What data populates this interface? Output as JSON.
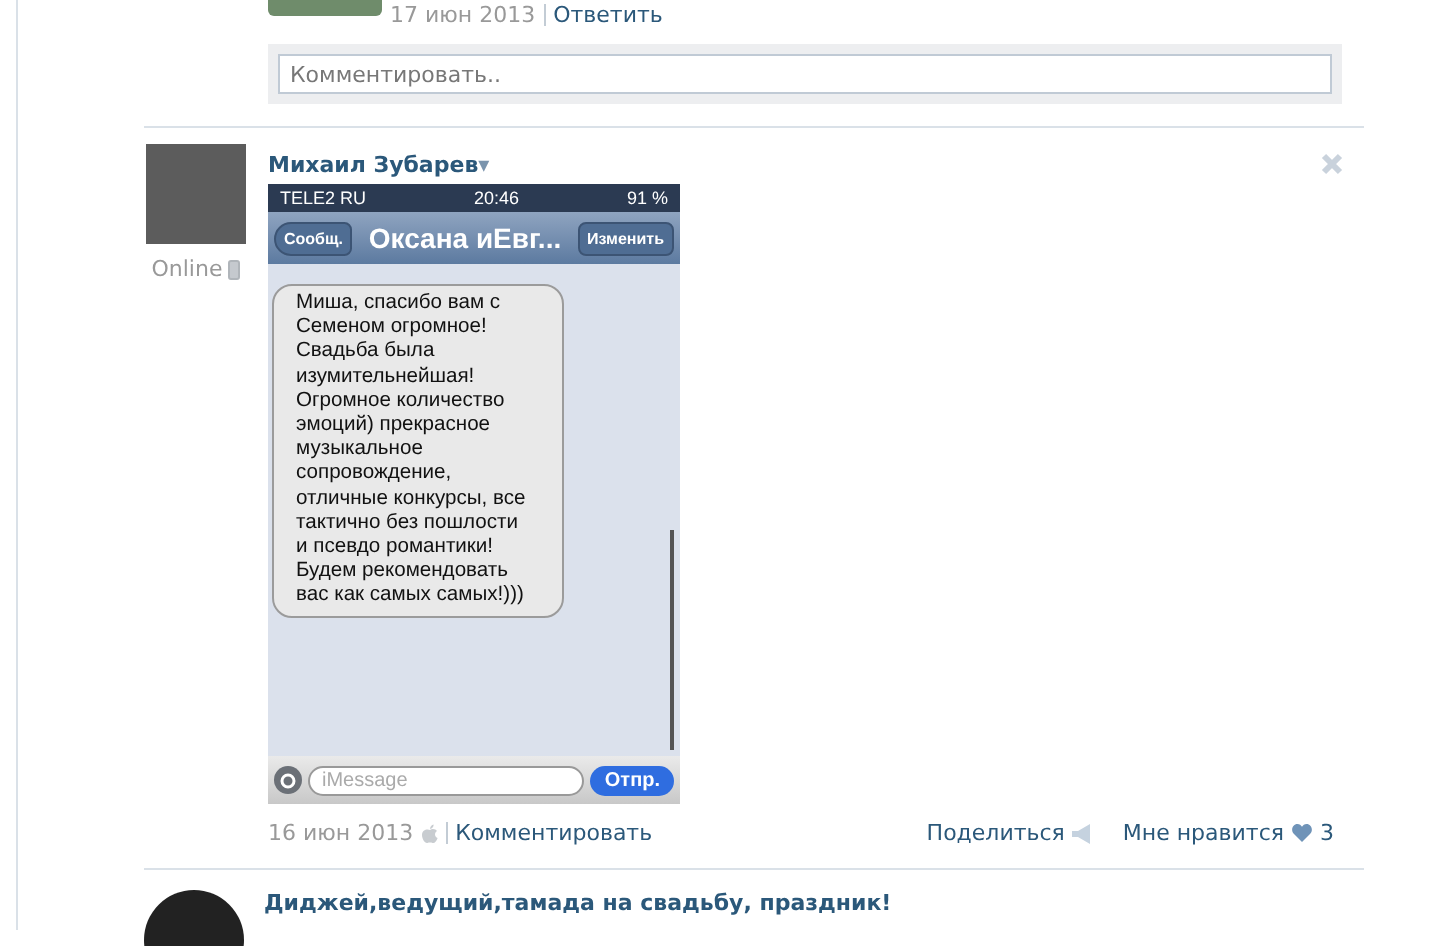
{
  "previous_comment": {
    "date": "17 июн 2013",
    "reply_link": "Ответить"
  },
  "comment_field": {
    "placeholder": "Комментировать.."
  },
  "post": {
    "author": "Михаил Зубарев",
    "author_menu_glyph": "▾",
    "status": "Online",
    "attachment": {
      "carrier": "TELE2 RU",
      "time": "20:46",
      "battery": "91 %",
      "back_button": "Сообщ.",
      "title": "Оксана иЕвг...",
      "edit_button": "Изменить",
      "message_lines": [
        "Миша, спасибо вам с",
        "Семеном огромное!",
        "Свадьба была",
        "изумительнейшая!",
        "Огромное количество",
        "эмоций) прекрасное",
        "музыкальное",
        "сопровождение,",
        "отличные конкурсы, все",
        "тактично без пошлости",
        "и псевдо романтики!",
        "Будем рекомендовать",
        "вас как самых самых!)))"
      ],
      "input_placeholder": "iMessage",
      "send_button": "Отпр."
    },
    "date": "16 июн 2013",
    "comment_link": "Комментировать",
    "share_link": "Поделиться",
    "like_link": "Мне нравится",
    "like_count": "3"
  },
  "next_post": {
    "title": "Диджей,ведущий,тамада на свадьбу, праздник!"
  }
}
